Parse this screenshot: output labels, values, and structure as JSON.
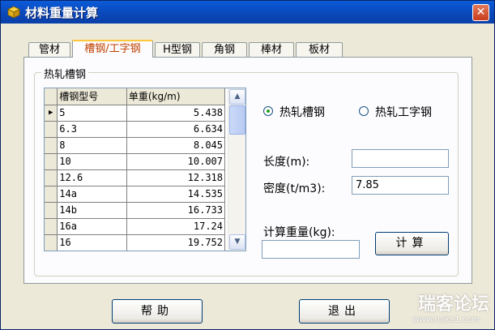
{
  "window": {
    "title": "材料重量计算",
    "close_label": "✕"
  },
  "tabs": [
    {
      "label": "管材",
      "active": false
    },
    {
      "label": "槽钢/工字钢",
      "active": true
    },
    {
      "label": "H型钢",
      "active": false
    },
    {
      "label": "角钢",
      "active": false
    },
    {
      "label": "棒材",
      "active": false
    },
    {
      "label": "板材",
      "active": false
    }
  ],
  "group": {
    "title": "热轧槽钢"
  },
  "grid": {
    "columns": [
      "槽钢型号",
      "单重(kg/m)"
    ],
    "current_row_marker": "▶",
    "rows": [
      [
        "5",
        "5.438"
      ],
      [
        "6.3",
        "6.634"
      ],
      [
        "8",
        "8.045"
      ],
      [
        "10",
        "10.007"
      ],
      [
        "12.6",
        "12.318"
      ],
      [
        "14a",
        "14.535"
      ],
      [
        "14b",
        "16.733"
      ],
      [
        "16a",
        "17.24"
      ],
      [
        "16",
        "19.752"
      ]
    ],
    "scroll_up": "▲",
    "scroll_down": "▼"
  },
  "options": {
    "channel_label": "热轧槽钢",
    "ibeam_label": "热轧工字钢",
    "selected": "channel"
  },
  "fields": {
    "length_label": "长度(m):",
    "length_value": "",
    "density_label": "密度(t/m3):",
    "density_value": "7.85",
    "weight_label": "计算重量(kg):",
    "weight_value": ""
  },
  "buttons": {
    "calculate": "计算",
    "help": "帮助",
    "exit": "退出"
  },
  "watermark": {
    "main": "瑞客论坛",
    "sub": "www.ruike1.com"
  }
}
